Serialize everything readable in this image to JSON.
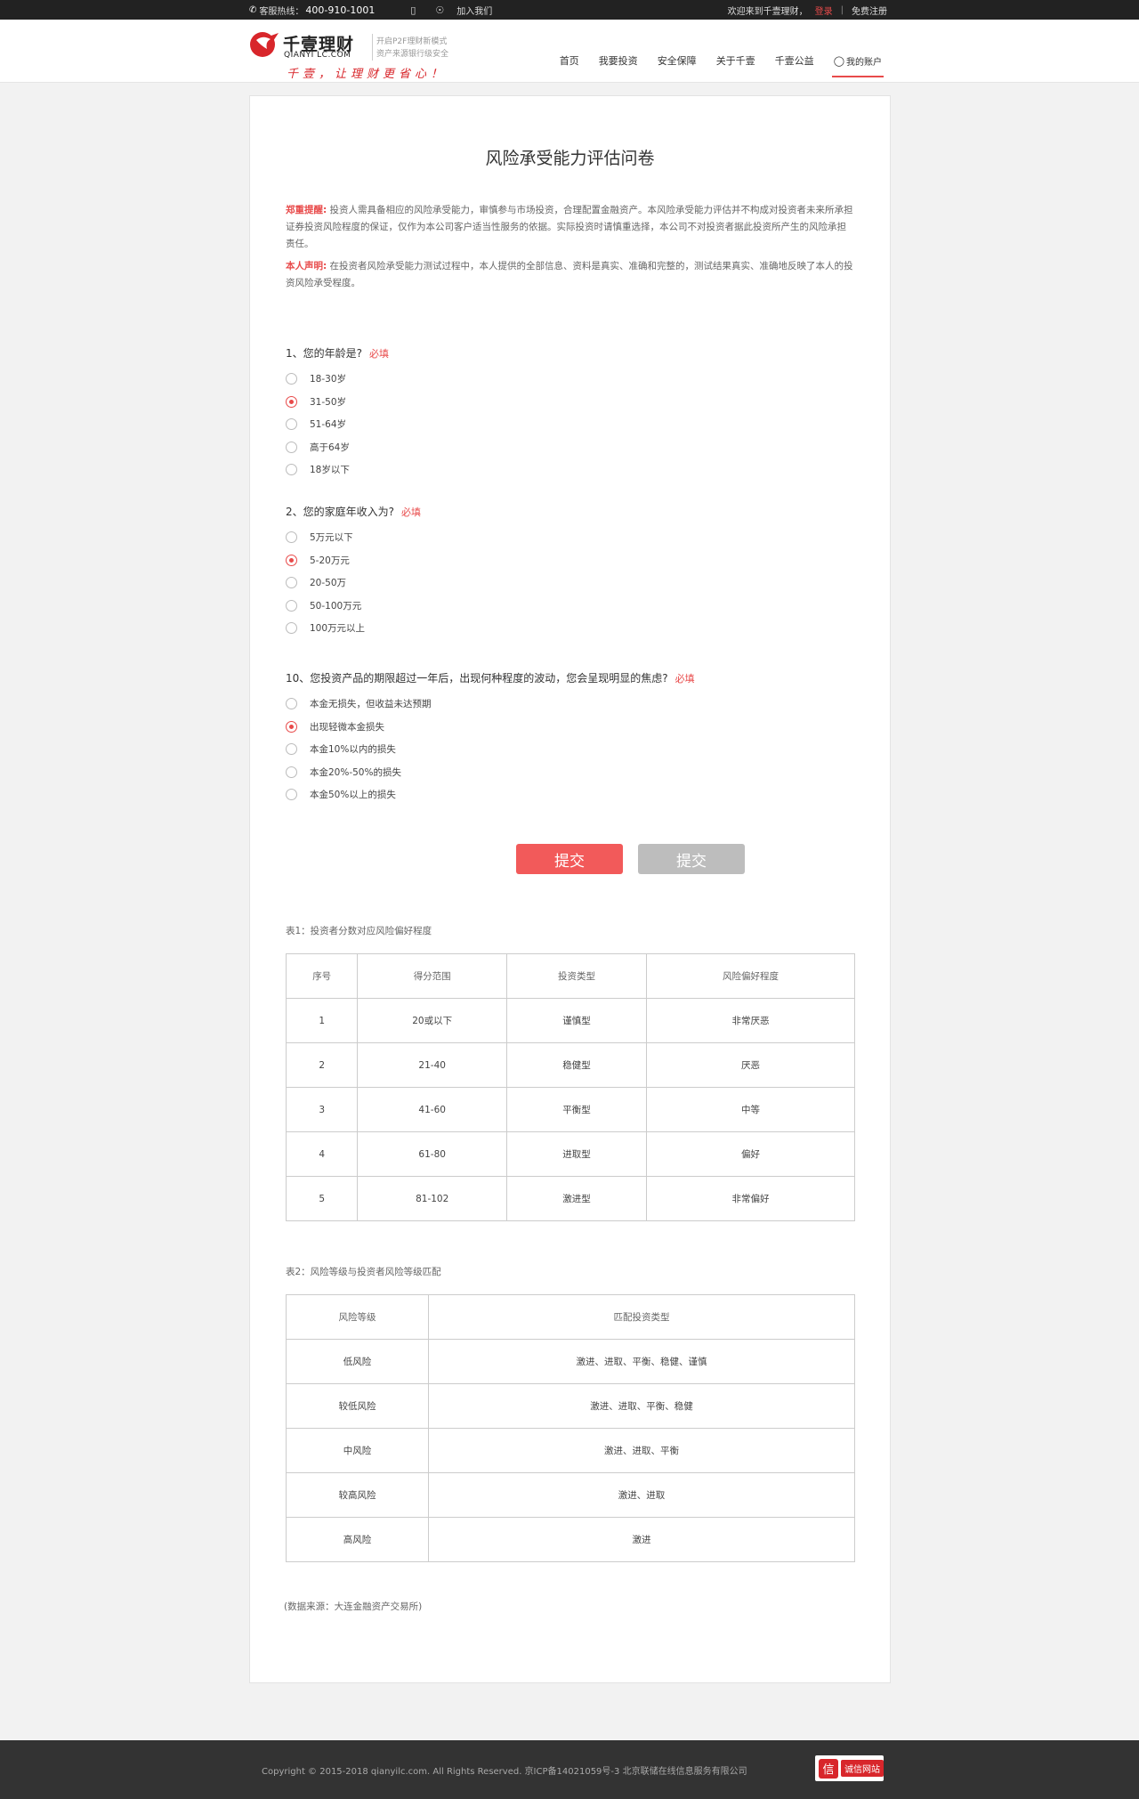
{
  "topbar": {
    "hotline_label": "客服热线：",
    "hotline_number": "400-910-1001",
    "join_label": "加入我们",
    "welcome": "欢迎来到千壹理财，",
    "login": "登录",
    "separator": "|",
    "register": "免费注册"
  },
  "header": {
    "logo_name": "千壹理财",
    "logo_domain": "QIANYI LC.COM",
    "tagline_1": "开启P2F理财新模式",
    "tagline_2": "资产来源银行级安全",
    "slogan": "千壹，让理财更省心！",
    "nav": [
      "首页",
      "我要投资",
      "安全保障",
      "关于千壹",
      "千壹公益"
    ],
    "account_label": "我的账户",
    "brand_color": "#d8262b"
  },
  "page": {
    "title": "风险承受能力评估问卷",
    "notice_1_label": "郑重提醒:",
    "notice_1_text": "投资人需具备相应的风险承受能力，审慎参与市场投资，合理配置金融资产。本风险承受能力评估并不构成对投资者未来所承担证券投资风险程度的保证，仅作为本公司客户适当性服务的依据。实际投资时请慎重选择，本公司不对投资者据此投资所产生的风险承担责任。",
    "notice_2_label": "本人声明:",
    "notice_2_text": "在投资者风险承受能力测试过程中，本人提供的全部信息、资料是真实、准确和完整的，测试结果真实、准确地反映了本人的投资风险承受程度。"
  },
  "questions": [
    {
      "title": "1、您的年龄是?",
      "required": "必填",
      "options": [
        "18-30岁",
        "31-50岁",
        "51-64岁",
        "高于64岁",
        "18岁以下"
      ],
      "selected_index": 1
    },
    {
      "title": "2、您的家庭年收入为?",
      "required": "必填",
      "options": [
        "5万元以下",
        "5-20万元",
        "20-50万",
        "50-100万元",
        "100万元以上"
      ],
      "selected_index": 1
    },
    {
      "title": "10、您投资产品的期限超过一年后，出现何种程度的波动，您会呈现明显的焦虑?",
      "required": "必填",
      "options": [
        "本金无损失，但收益未达预期",
        "出现轻微本金损失",
        "本金10%以内的损失",
        "本金20%-50%的损失",
        "本金50%以上的损失"
      ],
      "selected_index": 1
    }
  ],
  "buttons": {
    "submit_primary": "提交",
    "submit_secondary": "提交"
  },
  "table1": {
    "caption": "表1：投资者分数对应风险偏好程度",
    "headers": [
      "序号",
      "得分范围",
      "投资类型",
      "风险偏好程度"
    ],
    "rows": [
      [
        "1",
        "20或以下",
        "谨慎型",
        "非常厌恶"
      ],
      [
        "2",
        "21-40",
        "稳健型",
        "厌恶"
      ],
      [
        "3",
        "41-60",
        "平衡型",
        "中等"
      ],
      [
        "4",
        "61-80",
        "进取型",
        "偏好"
      ],
      [
        "5",
        "81-102",
        "激进型",
        "非常偏好"
      ]
    ]
  },
  "table2": {
    "caption": "表2：风险等级与投资者风险等级匹配",
    "headers": [
      "风险等级",
      "匹配投资类型"
    ],
    "rows": [
      [
        "低风险",
        "激进、进取、平衡、稳健、谨慎"
      ],
      [
        "较低风险",
        "激进、进取、平衡、稳健"
      ],
      [
        "中风险",
        "激进、进取、平衡"
      ],
      [
        "较高风险",
        "激进、进取"
      ],
      [
        "高风险",
        "激进"
      ]
    ]
  },
  "source": "(数据来源：大连金融资产交易所)",
  "footer": {
    "copyright": "Copyright © 2015-2018 qianyilc.com. All Rights Reserved. 京ICP备14021059号-3 北京联储在线信息服务有限公司",
    "badge_icon": "信",
    "badge_text": "诚信网站"
  }
}
